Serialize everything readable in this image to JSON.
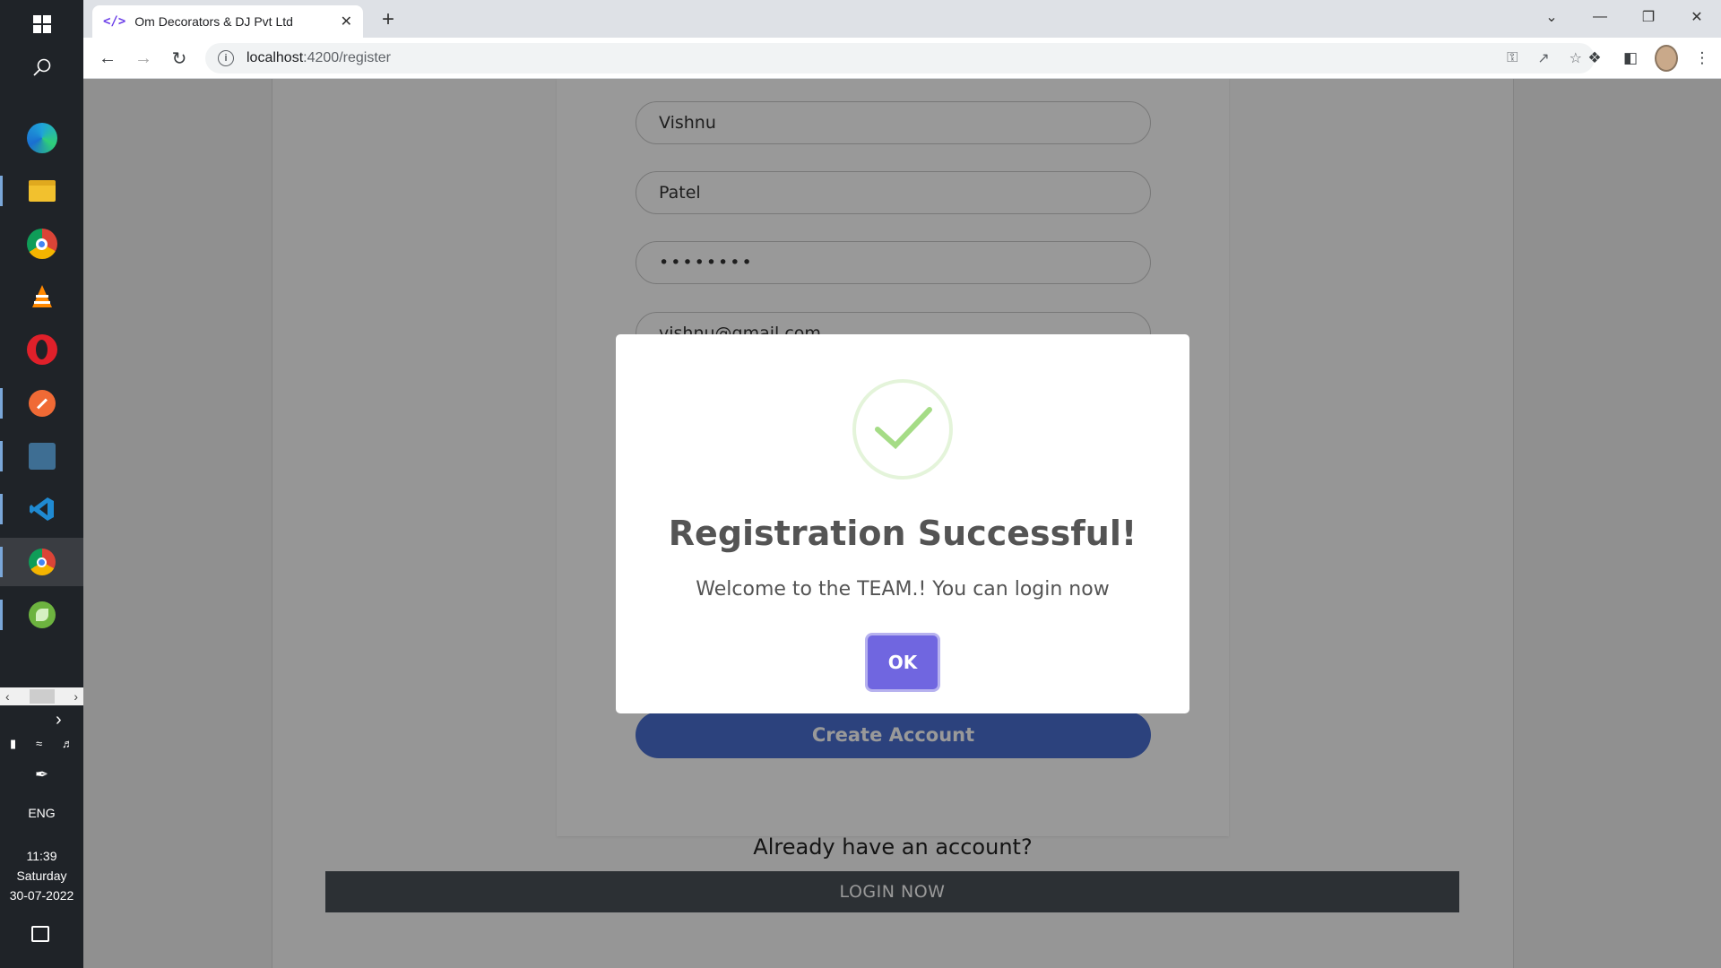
{
  "taskbar": {
    "apps": [
      {
        "name": "edge-icon",
        "color": "#1fa3d9"
      },
      {
        "name": "file-explorer-icon",
        "color": "#f2c12e"
      },
      {
        "name": "chrome-icon",
        "color": "#db4437"
      },
      {
        "name": "vlc-icon",
        "color": "#ff8800"
      },
      {
        "name": "opera-icon",
        "color": "#e0202a"
      },
      {
        "name": "postman-icon",
        "color": "#f06a35"
      },
      {
        "name": "mysql-workbench-icon",
        "color": "#3e6e93"
      },
      {
        "name": "vscode-icon",
        "color": "#1f8ad2"
      },
      {
        "name": "chrome-profile-icon",
        "color": "#db4437"
      },
      {
        "name": "spring-tool-suite-icon",
        "color": "#6db33f"
      }
    ],
    "language": "ENG",
    "time": "11:39",
    "day": "Saturday",
    "date": "30-07-2022"
  },
  "browser": {
    "tab_title": "Om Decorators & DJ Pvt Ltd",
    "tab_favicon": "</>",
    "url_host": "localhost",
    "url_path": ":4200/register"
  },
  "form": {
    "first_name": "Vishnu",
    "last_name": "Patel",
    "password_masked": "••••••••",
    "email_partial": "vishnu@gmail.com",
    "create_label": "Create Account",
    "already_text": "Already have an account?",
    "login_label": "LOGIN NOW"
  },
  "modal": {
    "title": "Registration Successful!",
    "text": "Welcome to the TEAM.! You can login now",
    "ok_label": "OK",
    "check_color": "#a5dc86"
  }
}
